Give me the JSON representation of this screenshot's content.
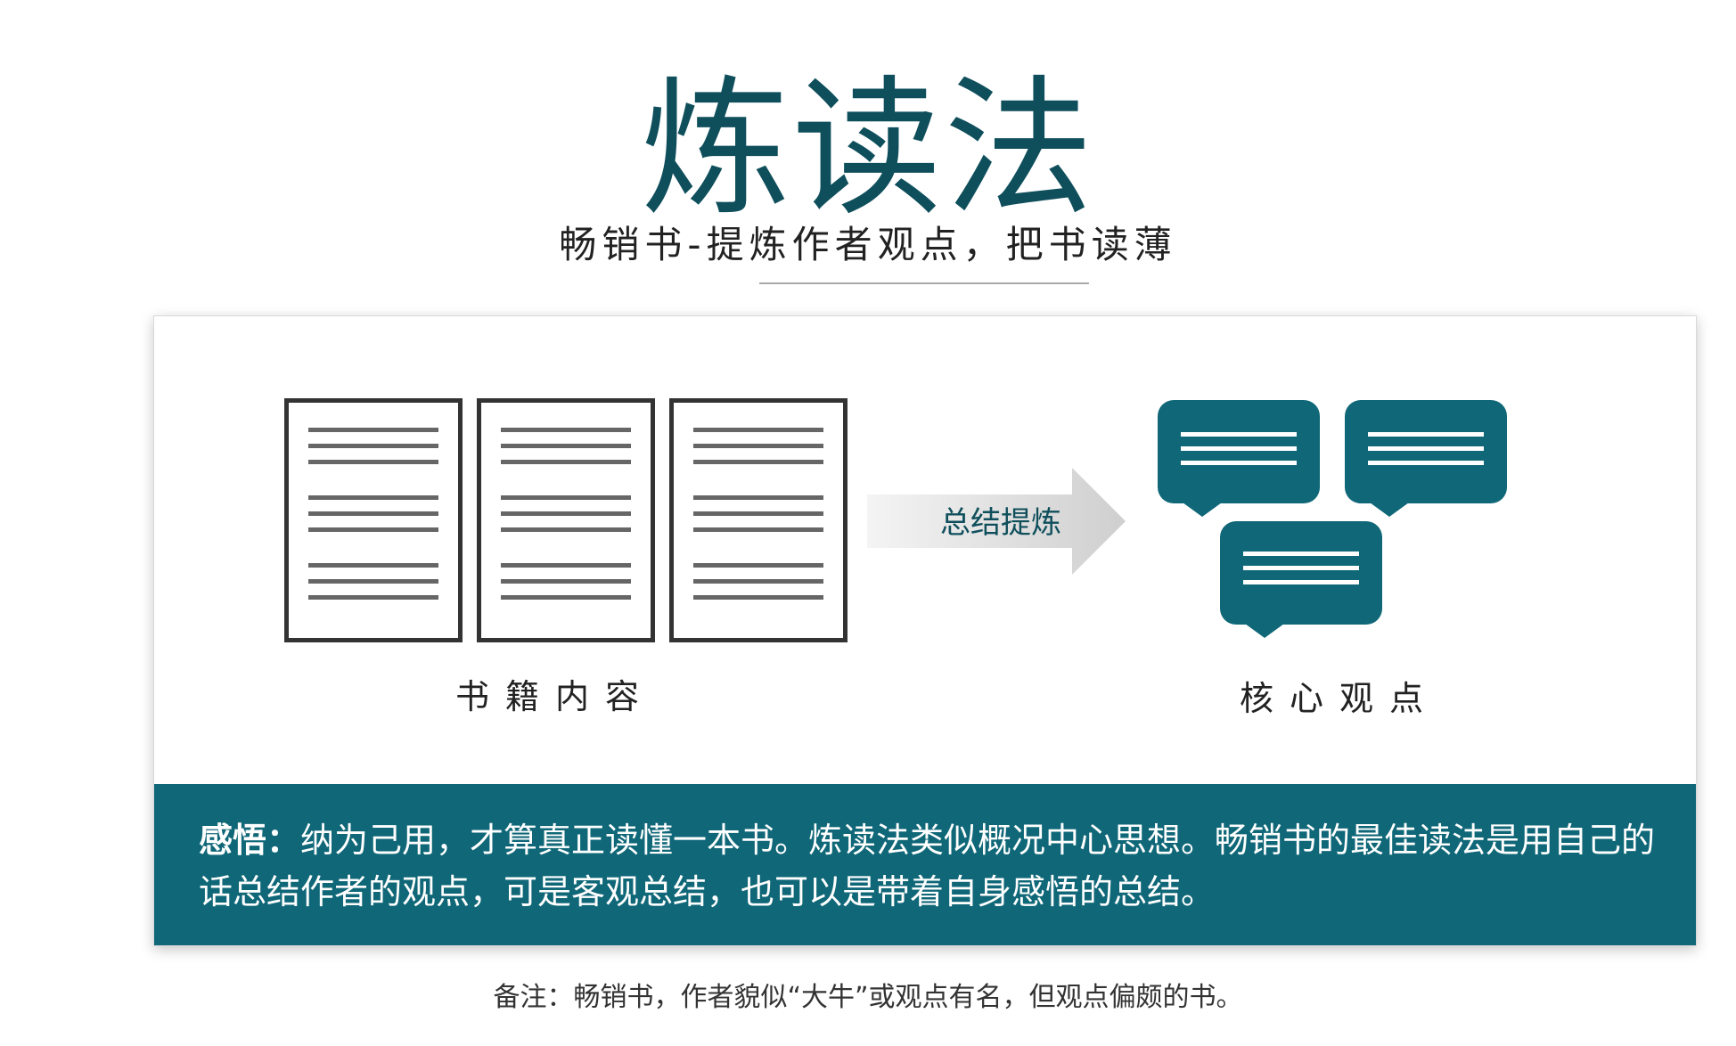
{
  "header": {
    "title": "炼读法",
    "subtitle": "畅销书-提炼作者观点，把书读薄"
  },
  "diagram": {
    "left_label": "书籍内容",
    "arrow_label": "总结提炼",
    "right_label": "核心观点",
    "document_count": 3,
    "bubble_count": 3,
    "colors": {
      "accent": "#0f6778",
      "title": "#0f4f5c",
      "document_border": "#333333"
    }
  },
  "insight": {
    "lead": "感悟：",
    "text": "纳为己用，才算真正读懂一本书。炼读法类似概况中心思想。畅销书的最佳读法是用自己的话总结作者的观点，可是客观总结，也可以是带着自身感悟的总结。"
  },
  "footnote": "备注：畅销书，作者貌似“大牛”或观点有名，但观点偏颇的书。"
}
